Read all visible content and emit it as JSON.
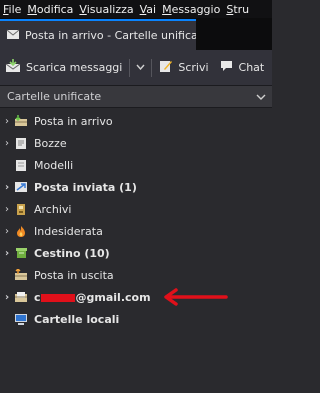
{
  "menubar": {
    "items": [
      {
        "mnemonic": "F",
        "rest": "ile"
      },
      {
        "mnemonic": "M",
        "rest": "odifica"
      },
      {
        "mnemonic": "V",
        "rest": "isualizza"
      },
      {
        "mnemonic": "V",
        "rest": "ai"
      },
      {
        "mnemonic": "M",
        "rest": "essaggio"
      },
      {
        "mnemonic": "S",
        "rest": "tru"
      }
    ]
  },
  "tab": {
    "label": "Posta in arrivo - Cartelle unificat"
  },
  "toolbar": {
    "get_messages": "Scarica messaggi",
    "write": "Scrivi",
    "chat": "Chat"
  },
  "folder_pane": {
    "header": "Cartelle unificate"
  },
  "folders": [
    {
      "label": "Posta in arrivo",
      "icon": "inbox-icon"
    },
    {
      "label": "Bozze",
      "icon": "drafts-icon"
    },
    {
      "label": "Modelli",
      "icon": "templates-icon"
    },
    {
      "label": "Posta inviata (1)",
      "icon": "sent-icon"
    },
    {
      "label": "Archivi",
      "icon": "archive-icon"
    },
    {
      "label": "Indesiderata",
      "icon": "junk-icon"
    },
    {
      "label": "Cestino (10)",
      "icon": "trash-icon"
    },
    {
      "label": "Posta in uscita",
      "icon": "outbox-icon"
    }
  ],
  "account": {
    "email_suffix": "@gmail.com"
  },
  "local_folders": {
    "label": "Cartelle locali"
  },
  "colors": {
    "accent": "#0a84ff",
    "annotation_arrow": "#e0101a",
    "background": "#2a2a2e"
  }
}
